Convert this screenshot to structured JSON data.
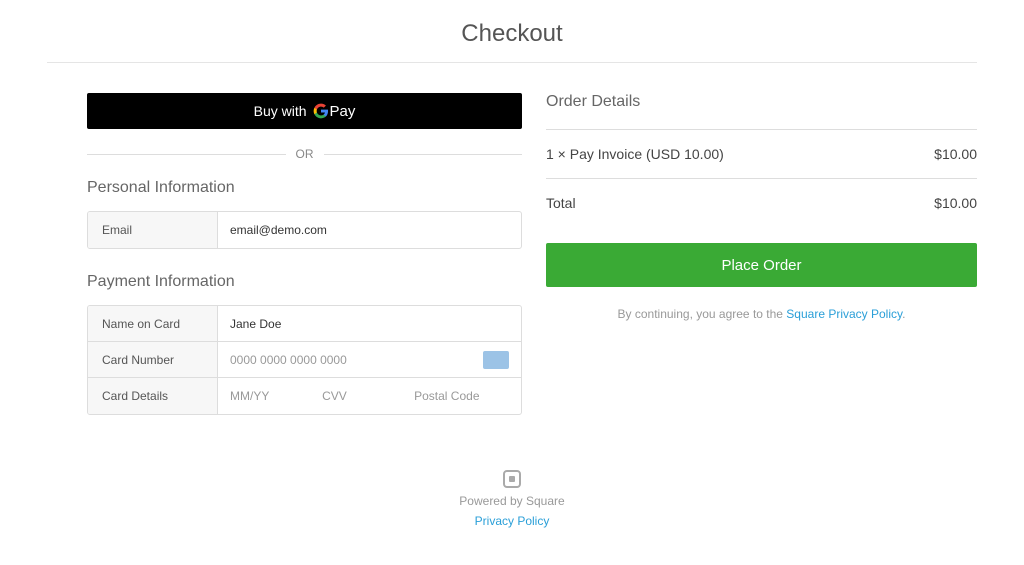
{
  "page": {
    "title": "Checkout"
  },
  "gpay": {
    "buy_with": "Buy with",
    "pay_word": "Pay"
  },
  "divider": {
    "or": "OR"
  },
  "personal": {
    "title": "Personal Information",
    "email_label": "Email",
    "email_value": "email@demo.com"
  },
  "payment": {
    "title": "Payment Information",
    "name_label": "Name on Card",
    "name_value": "Jane Doe",
    "card_num_label": "Card Number",
    "card_num_placeholder": "0000 0000 0000 0000",
    "details_label": "Card Details",
    "mmyy_placeholder": "MM/YY",
    "cvv_placeholder": "CVV",
    "postal_placeholder": "Postal Code"
  },
  "order": {
    "title": "Order Details",
    "line_item": "1 × Pay Invoice (USD 10.00)",
    "line_item_price": "$10.00",
    "total_label": "Total",
    "total_price": "$10.00",
    "place_order": "Place Order"
  },
  "consent": {
    "prefix": "By continuing, you agree to the ",
    "link_text": "Square Privacy Policy",
    "suffix": "."
  },
  "footer": {
    "powered": "Powered by Square",
    "privacy": "Privacy Policy"
  }
}
